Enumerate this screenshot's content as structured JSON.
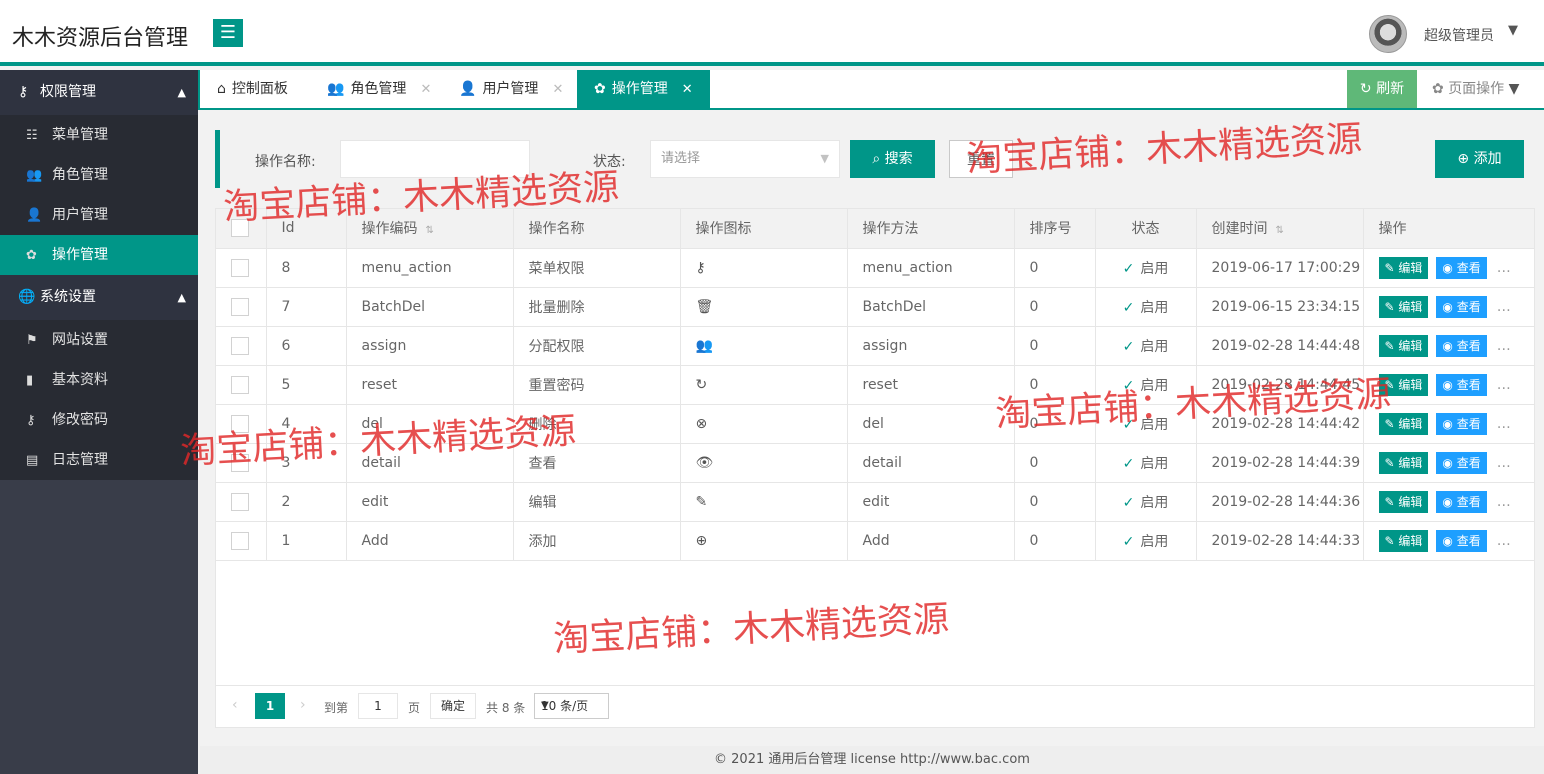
{
  "app": {
    "title": "木木资源后台管理",
    "user_name": "超级管理员"
  },
  "sidebar": {
    "groups": [
      {
        "label": "权限管理",
        "icon": "key-icon",
        "items": [
          {
            "label": "菜单管理",
            "icon": "list-icon"
          },
          {
            "label": "角色管理",
            "icon": "users-icon"
          },
          {
            "label": "用户管理",
            "icon": "user-icon"
          },
          {
            "label": "操作管理",
            "icon": "gear-icon",
            "active": true
          }
        ]
      },
      {
        "label": "系统设置",
        "icon": "globe-icon",
        "items": [
          {
            "label": "网站设置",
            "icon": "flag-icon"
          },
          {
            "label": "基本资料",
            "icon": "book-icon"
          },
          {
            "label": "修改密码",
            "icon": "key-icon"
          },
          {
            "label": "日志管理",
            "icon": "file-icon"
          }
        ]
      }
    ]
  },
  "tabs": [
    {
      "label": "控制面板",
      "icon": "home-icon"
    },
    {
      "label": "角色管理",
      "icon": "users-icon"
    },
    {
      "label": "用户管理",
      "icon": "user-icon"
    },
    {
      "label": "操作管理",
      "icon": "gear-icon",
      "active": true
    }
  ],
  "tabbar": {
    "refresh": "刷新",
    "page_ops": "页面操作"
  },
  "search": {
    "name_label": "操作名称:",
    "status_label": "状态:",
    "status_placeholder": "请选择",
    "search_button": "搜索",
    "reset_button": "重置",
    "add_button": "添加"
  },
  "table": {
    "headers": [
      "",
      "Id",
      "操作编码",
      "操作名称",
      "操作图标",
      "操作方法",
      "排序号",
      "状态",
      "创建时间",
      "操作"
    ],
    "rows": [
      {
        "id": "8",
        "code": "menu_action",
        "name": "菜单权限",
        "icon": "key-icon",
        "method": "menu_action",
        "sort": "0",
        "status": "启用",
        "created": "2019-06-17 17:00:29"
      },
      {
        "id": "7",
        "code": "BatchDel",
        "name": "批量删除",
        "icon": "trash-icon",
        "method": "BatchDel",
        "sort": "0",
        "status": "启用",
        "created": "2019-06-15 23:34:15"
      },
      {
        "id": "6",
        "code": "assign",
        "name": "分配权限",
        "icon": "users-icon",
        "method": "assign",
        "sort": "0",
        "status": "启用",
        "created": "2019-02-28 14:44:48"
      },
      {
        "id": "5",
        "code": "reset",
        "name": "重置密码",
        "icon": "reset-icon",
        "method": "reset",
        "sort": "0",
        "status": "启用",
        "created": "2019-02-28 14:44:45"
      },
      {
        "id": "4",
        "code": "del",
        "name": "删除",
        "icon": "close-circle-icon",
        "method": "del",
        "sort": "0",
        "status": "启用",
        "created": "2019-02-28 14:44:42"
      },
      {
        "id": "3",
        "code": "detail",
        "name": "查看",
        "icon": "eye-icon",
        "method": "detail",
        "sort": "0",
        "status": "启用",
        "created": "2019-02-28 14:44:39"
      },
      {
        "id": "2",
        "code": "edit",
        "name": "编辑",
        "icon": "edit-icon",
        "method": "edit",
        "sort": "0",
        "status": "启用",
        "created": "2019-02-28 14:44:36"
      },
      {
        "id": "1",
        "code": "Add",
        "name": "添加",
        "icon": "plus-circle-icon",
        "method": "Add",
        "sort": "0",
        "status": "启用",
        "created": "2019-02-28 14:44:33"
      }
    ],
    "edit_label": "编辑",
    "view_label": "查看",
    "more_label": "…"
  },
  "pagination": {
    "current_page": "1",
    "goto_label": "到第",
    "goto_value": "1",
    "page_unit": "页",
    "confirm": "确定",
    "total": "共 8 条",
    "page_size": "10 条/页"
  },
  "footer": {
    "text": "© 2021 通用后台管理 license   http://www.bac.com"
  },
  "watermark": {
    "text": "淘宝店铺：木木精选资源"
  }
}
